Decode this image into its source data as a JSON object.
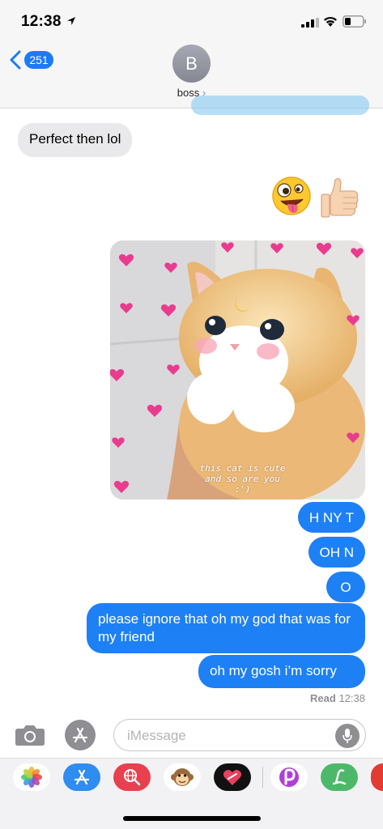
{
  "status_bar": {
    "time": "12:38",
    "icons": [
      "location-arrow-icon",
      "signal-icon",
      "wifi-icon",
      "battery-icon"
    ]
  },
  "nav": {
    "back_count": "251",
    "avatar_initial": "B",
    "contact_name": "boss",
    "chevron": "›"
  },
  "messages": [
    {
      "type": "received",
      "text": "Perfect then lol"
    },
    {
      "type": "sent-emoji",
      "emojis": [
        "zany-face",
        "thumbs-up"
      ]
    },
    {
      "type": "sent-image",
      "caption_lines": [
        "this cat is cute",
        "and so are you",
        ":')"
      ]
    },
    {
      "type": "sent",
      "text": "H NY T"
    },
    {
      "type": "sent",
      "text": "OH N"
    },
    {
      "type": "sent",
      "text": "O"
    },
    {
      "type": "sent",
      "text": "please ignore that oh my god that was for my friend"
    },
    {
      "type": "sent",
      "text": "oh my gosh i’m sorry"
    }
  ],
  "read_receipt": {
    "label": "Read",
    "time": "12:38"
  },
  "compose": {
    "placeholder": "iMessage"
  },
  "app_drawer": {
    "apps": [
      "photos-app",
      "app-store-app",
      "web-images-app",
      "animoji-app",
      "digital-touch-app",
      "picsart-app",
      "green-l-app",
      "red-app"
    ]
  },
  "colors": {
    "sent_bubble": "#1e80f5",
    "received_bubble": "#e9e9eb",
    "badge": "#1a7cf5"
  }
}
